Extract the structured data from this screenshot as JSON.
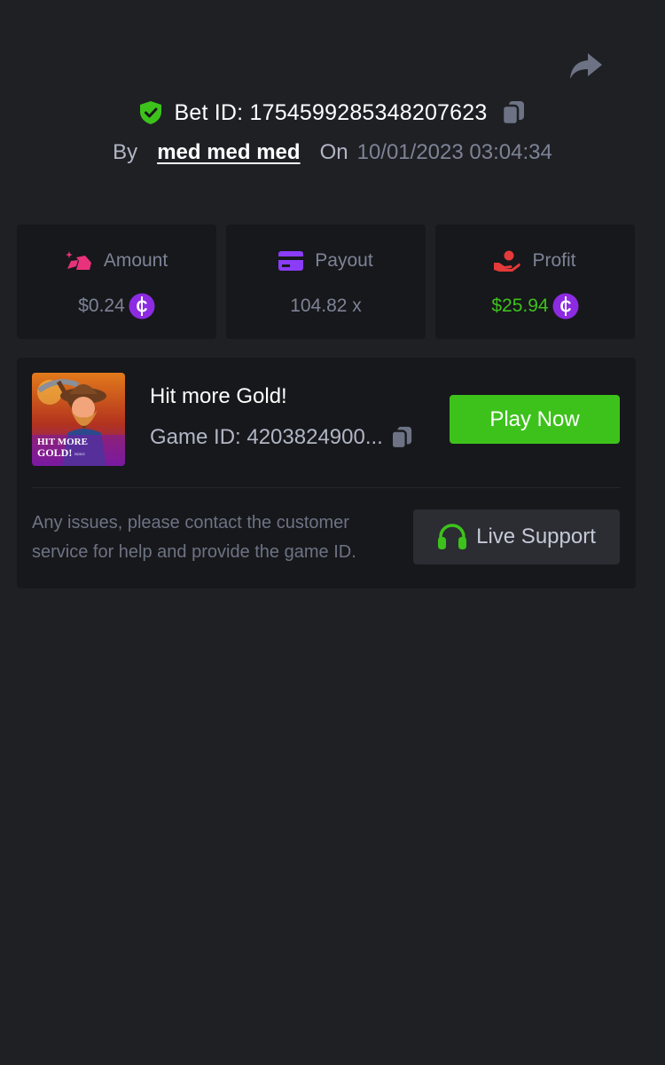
{
  "header": {
    "share_icon": "share-icon",
    "bet_id_label": "Bet ID:",
    "bet_id_value": "1754599285348207623",
    "by_label": "By",
    "username": "med med med",
    "on_label": "On",
    "datetime": "10/01/2023 03:04:34"
  },
  "stats": {
    "amount": {
      "label": "Amount",
      "value": "$0.24",
      "icon": "amount-icon",
      "icon_color": "#e8327c"
    },
    "payout": {
      "label": "Payout",
      "value": "104.82 x",
      "icon": "card-icon",
      "icon_color": "#8b3cf7"
    },
    "profit": {
      "label": "Profit",
      "value": "$25.94",
      "icon": "profit-hand-icon",
      "icon_color": "#e33a3a"
    }
  },
  "game": {
    "title": "Hit more Gold!",
    "game_id": "Game ID: 4203824900...",
    "thumbnail_text": "HIT MORE GOLD!",
    "play_button": "Play Now",
    "help_text": "Any issues, please contact the customer service for help and provide the game ID.",
    "support_button": "Live Support"
  },
  "colors": {
    "background": "#1f2024",
    "card": "#17181b",
    "accent_green": "#3dc21c",
    "coin_purple": "#8d2be2"
  }
}
